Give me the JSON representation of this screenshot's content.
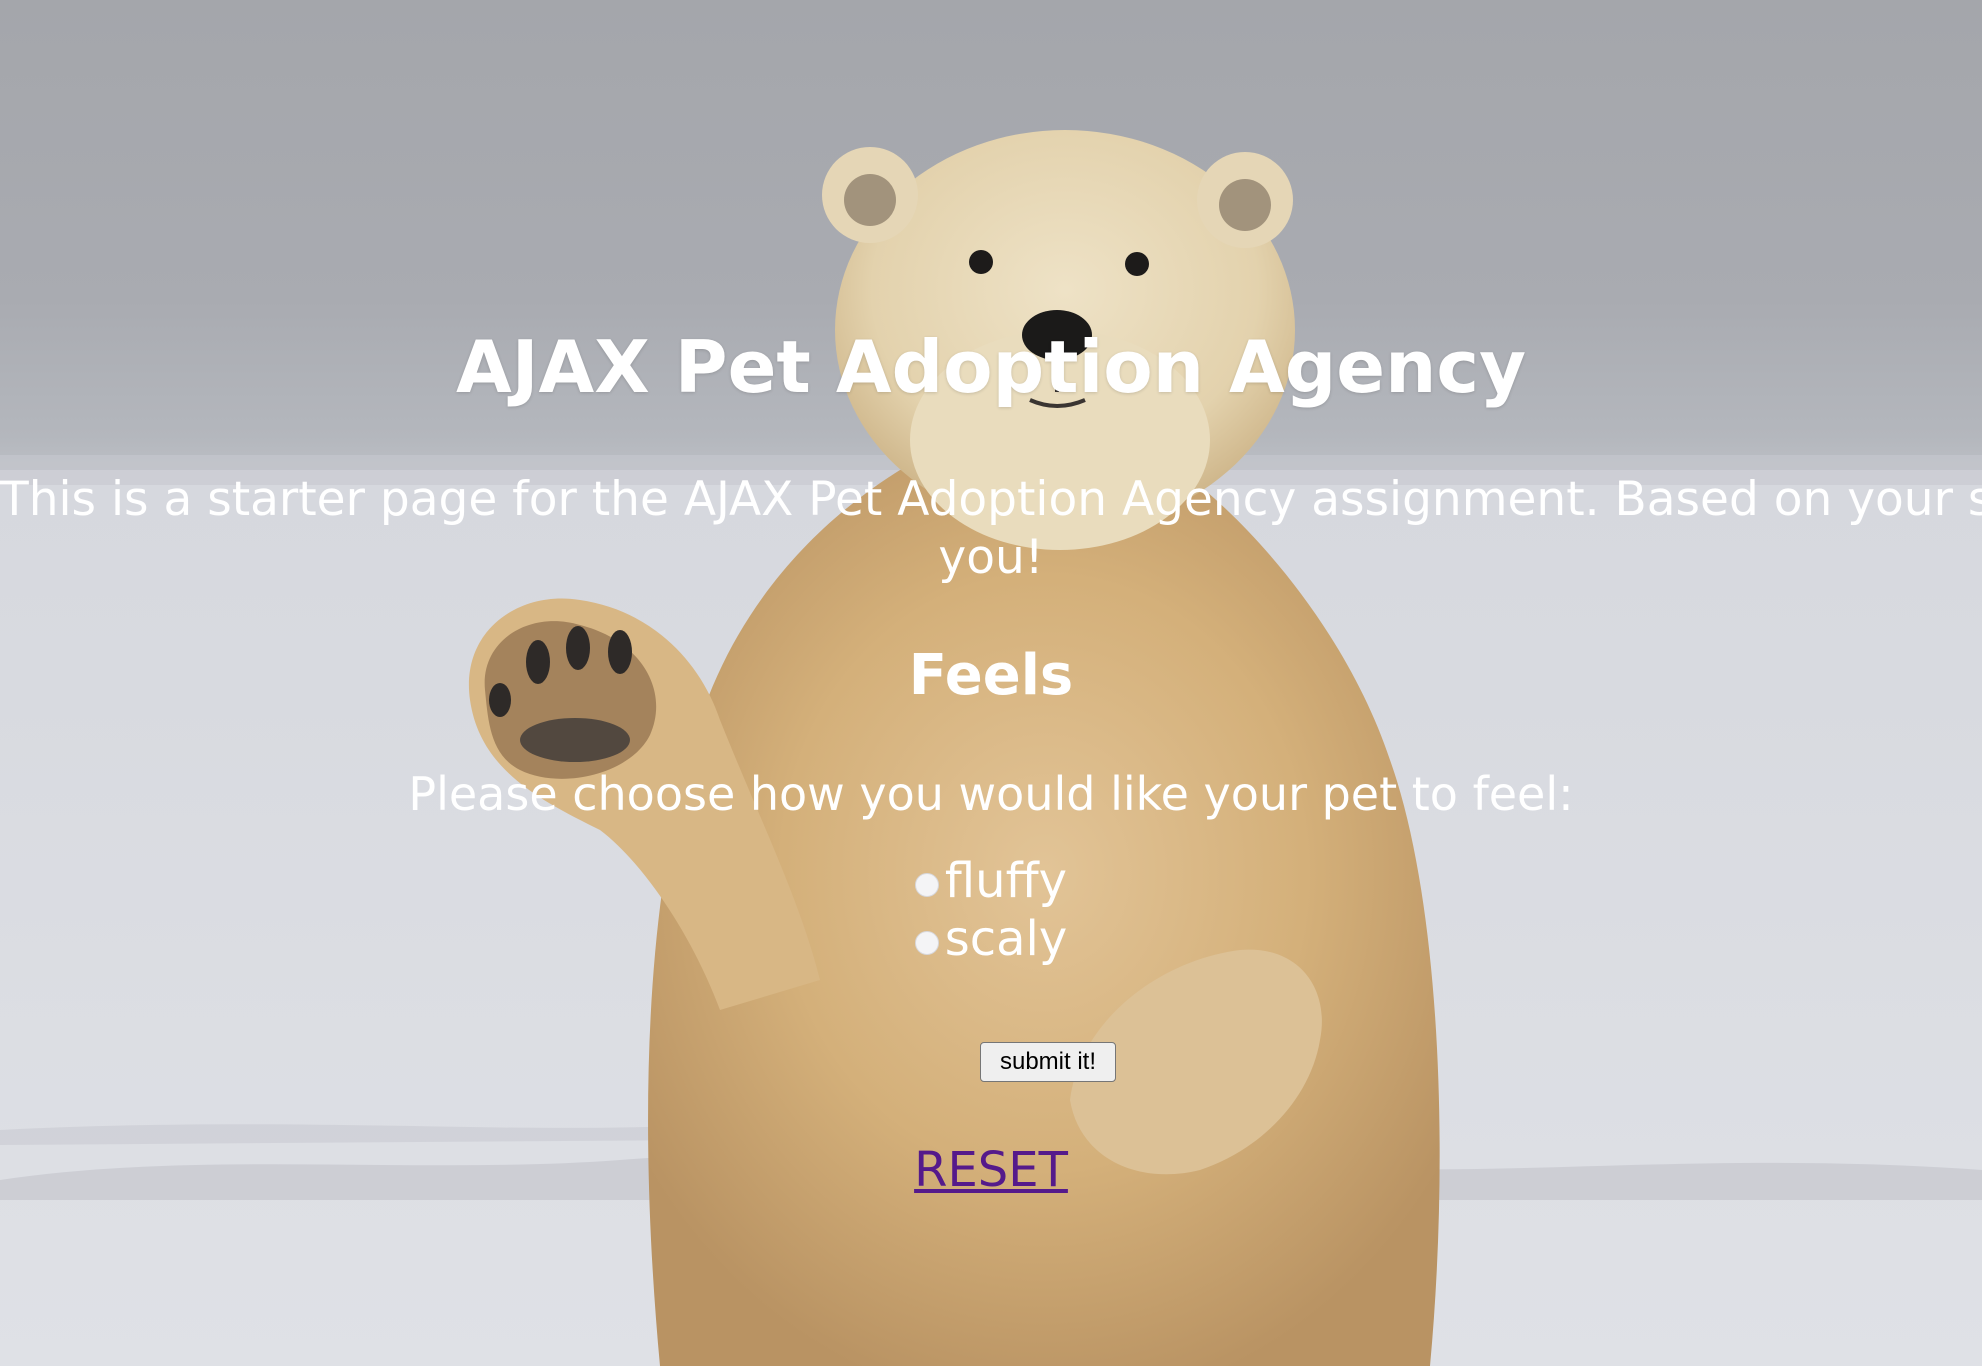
{
  "page": {
    "title": "AJAX Pet Adoption Agency",
    "intro_line1": "This is a starter page for the AJAX Pet Adoption Agency assignment. Based on your selection it would assign a pet for",
    "intro_line2": "you!",
    "section_title": "Feels",
    "prompt": "Please choose how you would like your pet to feel:"
  },
  "form": {
    "options": [
      {
        "label": "fluffy",
        "value": "fluffy"
      },
      {
        "label": "scaly",
        "value": "scaly"
      }
    ],
    "submit_label": "submit it!"
  },
  "reset": {
    "label": "RESET"
  },
  "colors": {
    "text": "#ffffff",
    "link_visited": "#551a8b"
  }
}
